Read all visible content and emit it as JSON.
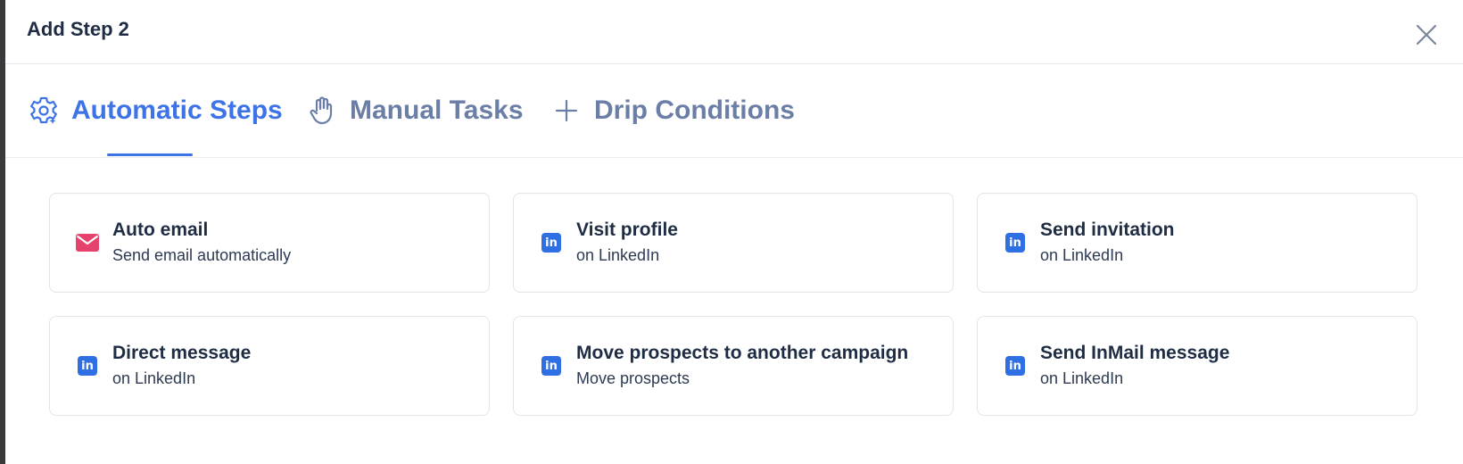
{
  "modal": {
    "title": "Add Step 2",
    "close_icon": "close-icon"
  },
  "tabs": [
    {
      "label": "Automatic Steps",
      "icon": "gear-icon",
      "active": true
    },
    {
      "label": "Manual Tasks",
      "icon": "hand-icon",
      "active": false
    },
    {
      "label": "Drip Conditions",
      "icon": "plus-icon",
      "active": false
    }
  ],
  "colors": {
    "accent": "#3d73e6",
    "inactive_tab": "#6b7ea6",
    "email_icon": "#e5426d",
    "linkedin_icon": "#2f6fe4"
  },
  "cards": [
    {
      "title": "Auto email",
      "subtitle": "Send email automatically",
      "icon": "envelope-icon"
    },
    {
      "title": "Visit profile",
      "subtitle": "on LinkedIn",
      "icon": "linkedin-icon"
    },
    {
      "title": "Send invitation",
      "subtitle": "on LinkedIn",
      "icon": "linkedin-icon"
    },
    {
      "title": "Direct message",
      "subtitle": "on LinkedIn",
      "icon": "linkedin-icon"
    },
    {
      "title": "Move prospects to another campaign",
      "subtitle": "Move prospects",
      "icon": "linkedin-icon"
    },
    {
      "title": "Send InMail message",
      "subtitle": "on LinkedIn",
      "icon": "linkedin-icon"
    }
  ],
  "linkedin_glyph": "in"
}
